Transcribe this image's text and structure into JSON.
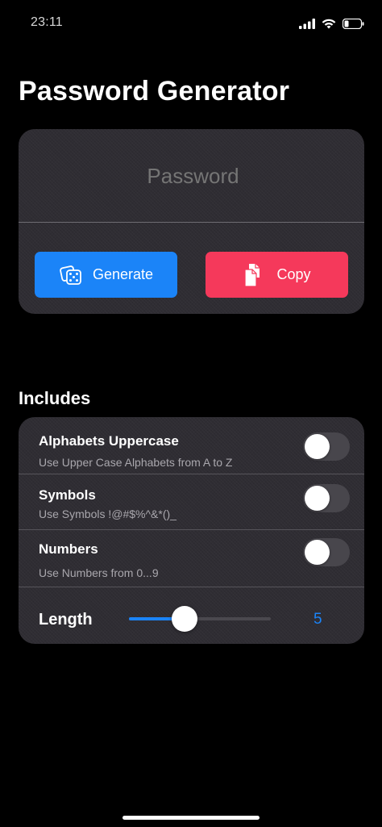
{
  "status": {
    "time": "23:11",
    "icons": [
      "cellular-signal-icon",
      "wifi-icon",
      "battery-icon"
    ]
  },
  "title": "Password Generator",
  "password": {
    "placeholder": "Password",
    "value": ""
  },
  "buttons": {
    "generate": {
      "label": "Generate",
      "icon": "dice-icon",
      "color": "#1b84f8"
    },
    "copy": {
      "label": "Copy",
      "icon": "copy-documents-icon",
      "color": "#f5395b"
    }
  },
  "includes": {
    "heading": "Includes",
    "options": [
      {
        "title": "Alphabets Uppercase",
        "description": "Use Upper Case Alphabets from A to Z",
        "enabled": false
      },
      {
        "title": "Symbols",
        "description": "Use Symbols !@#$%^&*()_",
        "enabled": false
      },
      {
        "title": "Numbers",
        "description": "Use Numbers from 0...9",
        "enabled": false
      }
    ],
    "length": {
      "label": "Length",
      "value": "5",
      "slider_fraction": 0.3
    }
  },
  "colors": {
    "accent": "#1b84f8",
    "danger": "#f5395b",
    "card": "#2f2d33",
    "background": "#000000"
  }
}
